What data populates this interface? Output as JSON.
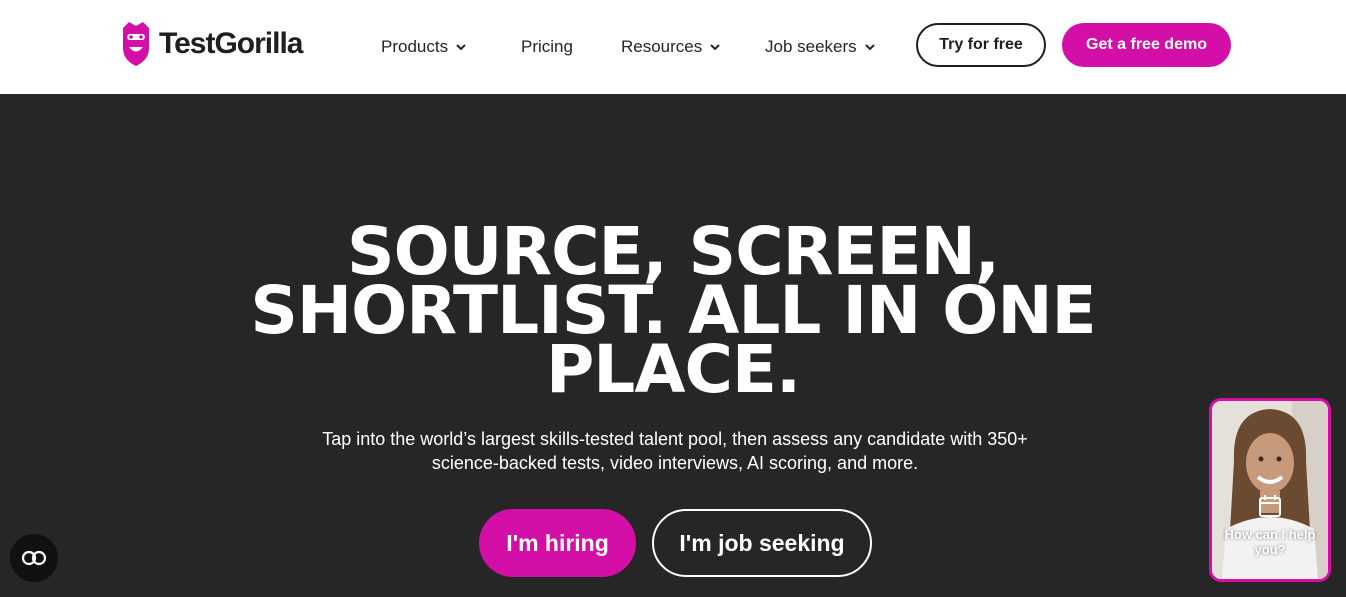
{
  "header": {
    "logo_text": "TestGorilla",
    "nav": [
      {
        "label": "Products",
        "has_dropdown": true
      },
      {
        "label": "Pricing",
        "has_dropdown": false
      },
      {
        "label": "Resources",
        "has_dropdown": true
      },
      {
        "label": "Job seekers",
        "has_dropdown": true
      }
    ],
    "try_label": "Try for free",
    "demo_label": "Get a free demo"
  },
  "hero": {
    "headline_lines": [
      "SOURCE, SCREEN,",
      "SHORTLIST. ALL IN ONE",
      "PLACE."
    ],
    "subtext_lines": [
      "Tap into the world’s largest skills-tested talent pool, then assess any candidate with 350+",
      "science-backed tests, video interviews, AI scoring, and more."
    ],
    "hiring_label": "I'm hiring",
    "seeking_label": "I'm job seeking"
  },
  "widget": {
    "help_lines": [
      "How can I help",
      "you?"
    ],
    "icon": "calendar-icon"
  },
  "accessibility": {
    "icon": "accessibility-toggle-icon"
  },
  "colors": {
    "brand": "#d40fa8",
    "dark": "#262626",
    "white": "#ffffff"
  }
}
